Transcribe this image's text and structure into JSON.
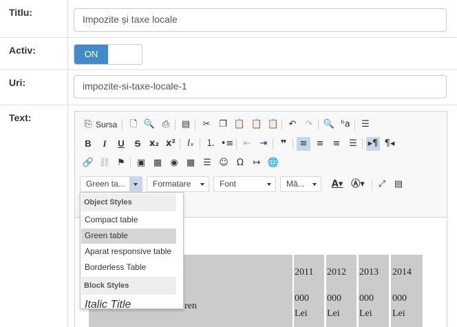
{
  "form": {
    "title_label": "Titlu:",
    "title_value": "Impozite și taxe locale",
    "active_label": "Activ:",
    "active_toggle": "ON",
    "uri_label": "Uri:",
    "uri_value": "impozite-si-taxe-locale-1",
    "text_label": "Text:"
  },
  "toolbar": {
    "source_label": "Sursa",
    "styles_combo": "Green ta...",
    "format_combo": "Formatare",
    "font_combo": "Font",
    "size_combo": "Mă..."
  },
  "styles_dropdown": {
    "object_header": "Object Styles",
    "items": [
      "Compact table",
      "Green table",
      "Aparat responsive table",
      "Borderless Table"
    ],
    "selected": "Green table",
    "block_header": "Block Styles",
    "italic_title": "Italic Title"
  },
  "content": {
    "years": [
      "2011",
      "2012",
      "2013",
      "2014"
    ],
    "cell_row1": [
      "000",
      "000",
      "000",
      "000"
    ],
    "cell_row2": [
      "Lei",
      "Lei",
      "Lei",
      "Lei"
    ],
    "partial_text": "ren"
  }
}
